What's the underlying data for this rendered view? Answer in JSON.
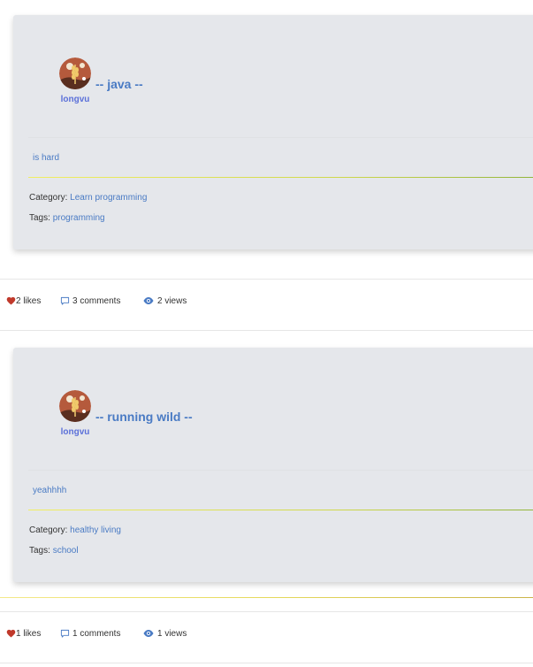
{
  "posts": [
    {
      "author": "longvu",
      "title": "-- java --",
      "content": "is hard",
      "category_label": "Category:",
      "category": "Learn programming",
      "tags_label": "Tags:",
      "tags": "programming",
      "likes": "2 likes",
      "comments": "3 comments",
      "views": "2 views"
    },
    {
      "author": "longvu",
      "title": "-- running wild --",
      "content": "yeahhhh",
      "category_label": "Category:",
      "category": "healthy living",
      "tags_label": "Tags:",
      "tags": "school",
      "likes": "1 likes",
      "comments": "1 comments",
      "views": "1 views"
    }
  ],
  "icons": {
    "like": "heart-icon",
    "comment": "comment-icon",
    "view": "eye-icon"
  },
  "colors": {
    "card_bg": "#e5e7eb",
    "link": "#4a7bc4",
    "author": "#5b70d9",
    "heart": "#c0392b"
  }
}
